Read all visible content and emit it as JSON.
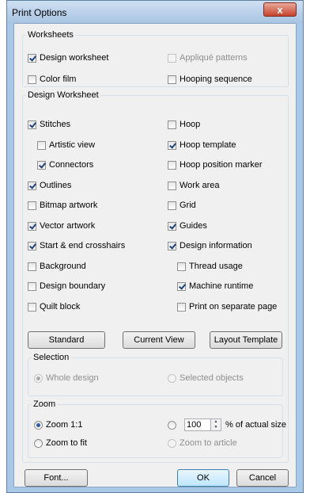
{
  "window": {
    "title": "Print Options",
    "close_glyph": "x"
  },
  "worksheets": {
    "legend": "Worksheets",
    "items": [
      {
        "label": "Design worksheet",
        "checked": true,
        "enabled": true
      },
      {
        "label": "Appliqué patterns",
        "checked": false,
        "enabled": false
      },
      {
        "label": "Color film",
        "checked": false,
        "enabled": true
      },
      {
        "label": "Hooping sequence",
        "checked": false,
        "enabled": true
      }
    ]
  },
  "design_worksheet": {
    "legend": "Design Worksheet",
    "left": [
      {
        "label": "Stitches",
        "checked": true
      },
      {
        "label": "Artistic view",
        "checked": false
      },
      {
        "label": "Connectors",
        "checked": true
      },
      {
        "label": "Outlines",
        "checked": true
      },
      {
        "label": "Bitmap artwork",
        "checked": false
      },
      {
        "label": "Vector artwork",
        "checked": true
      },
      {
        "label": "Start & end crosshairs",
        "checked": true
      },
      {
        "label": "Background",
        "checked": false
      },
      {
        "label": "Design boundary",
        "checked": false
      },
      {
        "label": "Quilt block",
        "checked": false
      }
    ],
    "right": [
      {
        "label": "Hoop",
        "checked": false
      },
      {
        "label": "Hoop template",
        "checked": true
      },
      {
        "label": "Hoop position marker",
        "checked": false
      },
      {
        "label": "Work area",
        "checked": false
      },
      {
        "label": "Grid",
        "checked": false
      },
      {
        "label": "Guides",
        "checked": true
      },
      {
        "label": "Design information",
        "checked": true
      },
      {
        "label": "Thread usage",
        "checked": false
      },
      {
        "label": "Machine runtime",
        "checked": true
      },
      {
        "label": "Print on separate page",
        "checked": false
      }
    ],
    "buttons": {
      "standard": "Standard",
      "current_view": "Current View",
      "layout_template": "Layout Template"
    },
    "selection": {
      "legend": "Selection",
      "options": [
        {
          "label": "Whole design",
          "selected": true,
          "enabled": false
        },
        {
          "label": "Selected objects",
          "selected": false,
          "enabled": false
        }
      ]
    },
    "zoom": {
      "legend": "Zoom",
      "zoom_1_1": {
        "label": "Zoom 1:1",
        "selected": true
      },
      "zoom_fit": {
        "label": "Zoom to fit",
        "selected": false
      },
      "percent": {
        "value": "100",
        "unit_label": "% of actual size",
        "selected": false
      },
      "zoom_article": {
        "label": "Zoom to article",
        "selected": false,
        "enabled": false
      }
    }
  },
  "footer": {
    "font": "Font...",
    "ok": "OK",
    "cancel": "Cancel"
  }
}
